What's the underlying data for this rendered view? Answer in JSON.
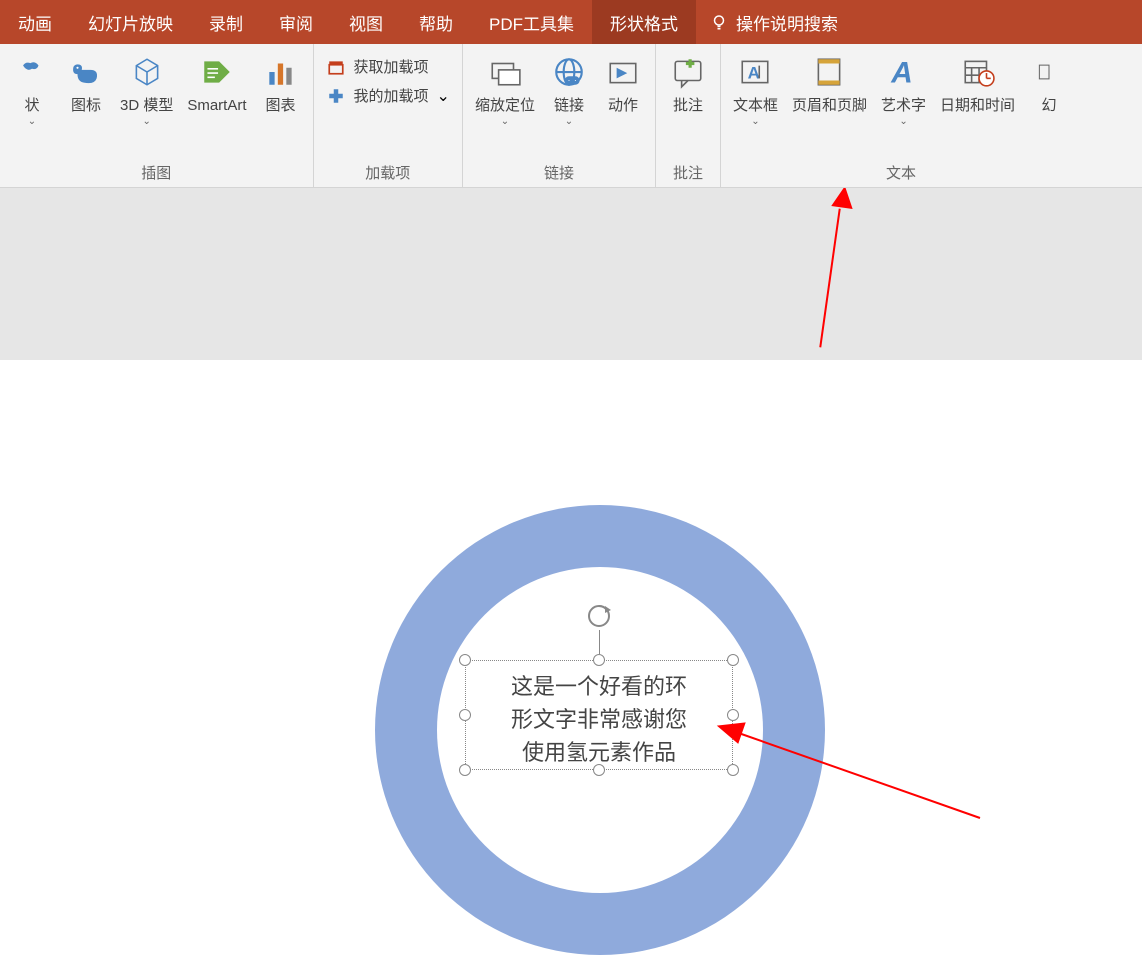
{
  "tabs": {
    "animation": "动画",
    "slideshow": "幻灯片放映",
    "record": "录制",
    "review": "审阅",
    "view": "视图",
    "help": "帮助",
    "pdf": "PDF工具集",
    "shapeformat": "形状格式"
  },
  "searchHelp": "操作说明搜索",
  "ribbon": {
    "shapes": "状",
    "icons": "图标",
    "models3d": "3D 模型",
    "smartart": "SmartArt",
    "chart": "图表",
    "groupInsert": "插图",
    "getAddins": "获取加载项",
    "myAddins": "我的加载项",
    "groupAddins": "加载项",
    "zoom": "缩放定位",
    "link": "链接",
    "action": "动作",
    "groupLinks": "链接",
    "comment": "批注",
    "groupComment": "批注",
    "textbox": "文本框",
    "headerfooter": "页眉和页脚",
    "wordart": "艺术字",
    "datetime": "日期和时间",
    "slidenum": "幻",
    "groupText": "文本"
  },
  "textboxContent": {
    "line1": "这是一个好看的环",
    "line2": "形文字非常感谢您",
    "line3": "使用氢元素作品"
  }
}
